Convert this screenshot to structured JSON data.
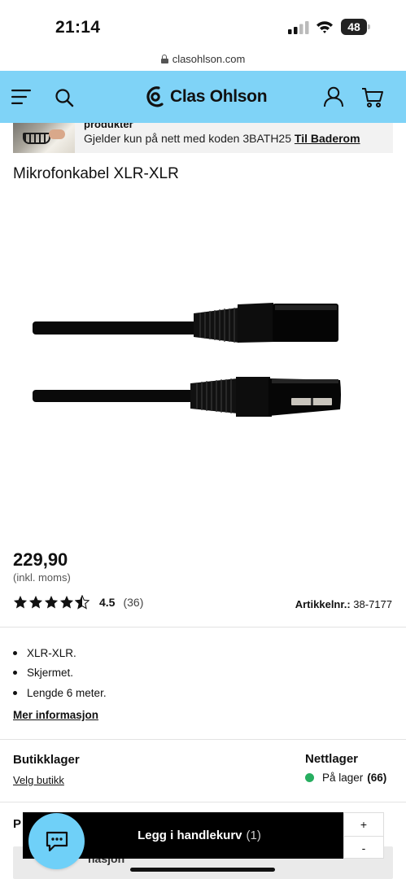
{
  "status_bar": {
    "time": "21:14",
    "battery": "48"
  },
  "browser": {
    "url": "clasohlson.com"
  },
  "header": {
    "logo_text": "Clas Ohlson",
    "icons": [
      "menu-icon",
      "search-icon",
      "account-icon",
      "cart-icon"
    ],
    "background_color": "#7fd3f7"
  },
  "promo": {
    "title": "produkter",
    "text": "Gjelder kun på nett med koden 3BATH25",
    "link": "Til Baderom"
  },
  "product": {
    "title": "Mikrofonkabel XLR-XLR",
    "price": "229,90",
    "price_note": "(inkl. moms)",
    "rating": {
      "stars": 4.5,
      "value": "4.5",
      "count": "(36)"
    },
    "article_label": "Artikkelnr.:",
    "article_number": "38-7177",
    "bullets": [
      "XLR-XLR.",
      "Skjermet.",
      "Lengde 6 meter."
    ],
    "more_info": "Mer informasjon"
  },
  "stock": {
    "store_title": "Butikklager",
    "store_link": "Velg butikk",
    "net_title": "Nettlager",
    "net_status": "På lager",
    "net_count": "(66)",
    "status_color": "#27ae60"
  },
  "bottom": {
    "section_label": "P",
    "strip_text": "nasjon",
    "cart_button_label": "Legg i handlekurv",
    "cart_button_count": "(1)",
    "qty_plus": "+",
    "qty_minus": "-",
    "chat_icon": "chat-icon"
  }
}
